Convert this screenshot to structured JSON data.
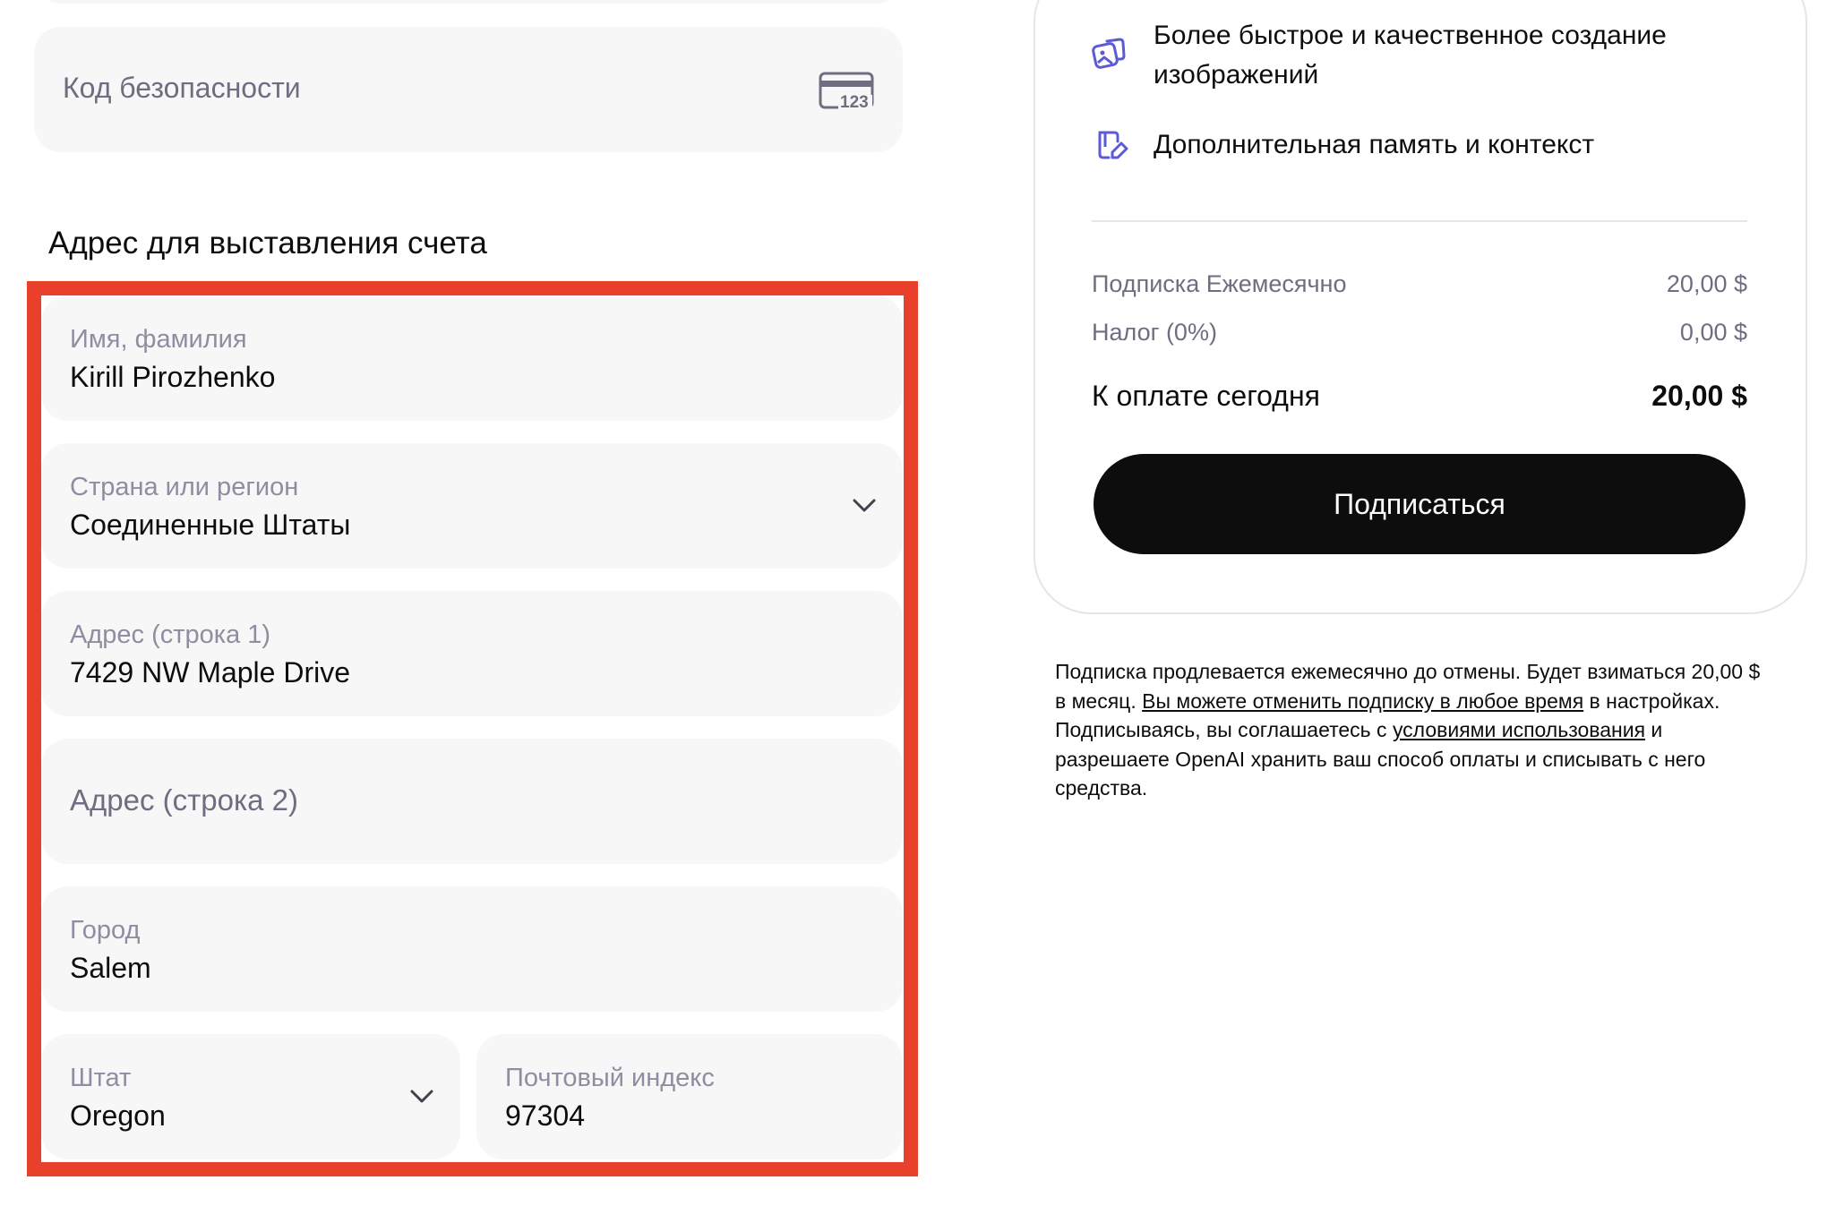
{
  "payment": {
    "security_code_placeholder": "Код безопасности",
    "security_code_icon_text": "123"
  },
  "billing": {
    "section_title": "Адрес для выставления счета",
    "name": {
      "label": "Имя, фамилия",
      "value": "Kirill Pirozhenko"
    },
    "country": {
      "label": "Страна или регион",
      "value": "Соединенные Штаты"
    },
    "address1": {
      "label": "Адрес (строка 1)",
      "value": "7429 NW Maple Drive"
    },
    "address2": {
      "placeholder": "Адрес (строка 2)"
    },
    "city": {
      "label": "Город",
      "value": "Salem"
    },
    "state": {
      "label": "Штат",
      "value": "Oregon"
    },
    "zip": {
      "label": "Почтовый индекс",
      "value": "97304"
    }
  },
  "summary": {
    "features": [
      {
        "icon": "images-icon",
        "text": "Более быстрое и качественное создание изображений"
      },
      {
        "icon": "memory-edit-icon",
        "text": "Дополнительная память и контекст"
      }
    ],
    "lines": [
      {
        "label": "Подписка Ежемесячно",
        "value": "20,00 $"
      },
      {
        "label": "Налог (0%)",
        "value": "0,00 $"
      }
    ],
    "total": {
      "label": "К оплате сегодня",
      "value": "20,00 $"
    },
    "subscribe_label": "Подписаться"
  },
  "legal": {
    "part1": "Подписка продлевается ежемесячно до отмены. Будет взиматься 20,00 $ в месяц. ",
    "cancel_link": "Вы можете отменить подписку в любое время",
    "part2": " в настройках. Подписываясь, вы соглашаетесь с ",
    "terms_link": "условиями использования",
    "part3": " и разрешаете OpenAI хранить ваш способ оплаты и списывать с него средства."
  },
  "colors": {
    "highlight_border": "#e8402a",
    "field_background": "#f7f7f8",
    "button_background": "#0d0d0d",
    "icon_accent": "#5b5bd6"
  }
}
